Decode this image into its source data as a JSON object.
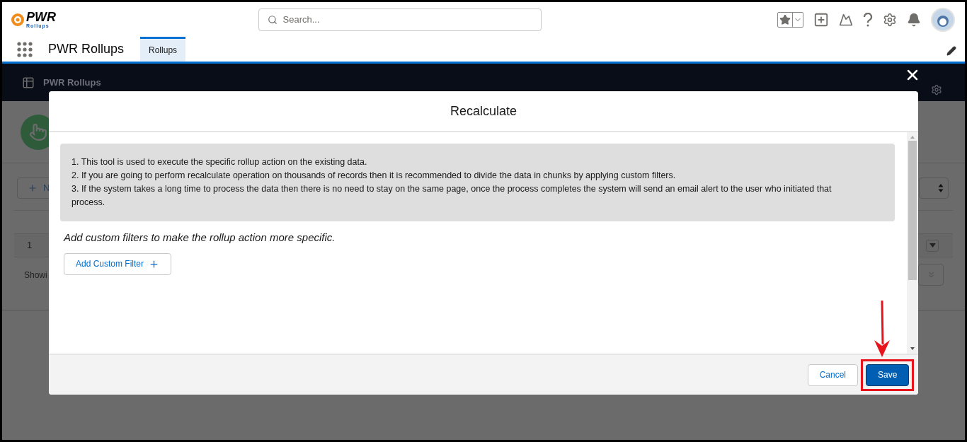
{
  "header": {
    "logo_text": "PWR",
    "logo_subtext": "Rollups",
    "search": {
      "placeholder": "Search..."
    }
  },
  "nav": {
    "app_name": "PWR Rollups",
    "tabs": [
      {
        "label": "Rollups",
        "selected": true
      }
    ]
  },
  "background": {
    "title": "PWR Rollups",
    "new_button_label": "N",
    "row_number": "1",
    "footer_text": "Showi"
  },
  "modal": {
    "title": "Recalculate",
    "instructions": [
      "1. This tool is used to execute the specific rollup action on the existing data.",
      "2. If you are going to perform recalculate operation on thousands of records then it is recommended to divide the data in chunks by applying custom filters.",
      "3. If the system takes a long time to process the data then there is no need to stay on the same page, once the process completes the system will send an email alert to the user who initiated that process."
    ],
    "hint": "Add custom filters to make the rollup action more specific.",
    "add_filter_button": "Add Custom Filter",
    "buttons": [
      {
        "kind": "neutral",
        "label": "Cancel",
        "highlighted": false
      },
      {
        "kind": "brand",
        "label": "Save",
        "highlighted": true
      }
    ]
  }
}
